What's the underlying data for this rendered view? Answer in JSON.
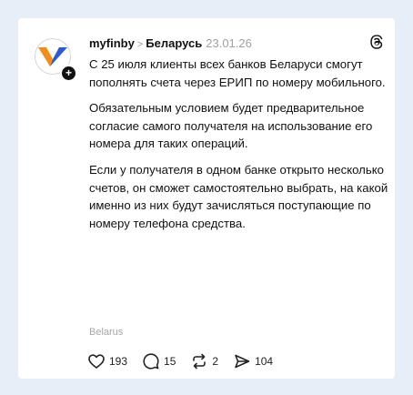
{
  "post": {
    "author": "myfinby",
    "separator": ">",
    "topic": "Беларусь",
    "date": "23.01.26",
    "paragraphs": [
      "С 25 июля клиенты всех банков Беларуси смогут пополнять счета через ЕРИП по номеру мобильного.",
      "Обязательным условием будет предварительное согласие самого получателя на использование его номера для таких операций.",
      "Если у получателя в одном банке открыто несколько счетов, он сможет самостоятельно выбрать, на какой именно из них будут зачисляться поступающие по номеру телефона средства."
    ],
    "topic_tag": "Belarus",
    "avatar_badge": "+",
    "stats": {
      "likes": "193",
      "replies": "15",
      "reposts": "2",
      "shares": "104"
    }
  },
  "colors": {
    "background": "#e6eef8",
    "logo_orange": "#f28c1b",
    "logo_blue": "#2a5bd7",
    "text": "#111111",
    "muted": "#a0a0a0"
  },
  "icons": {
    "threads": "threads-icon",
    "like": "heart-icon",
    "reply": "comment-icon",
    "repost": "repost-icon",
    "share": "share-icon"
  }
}
